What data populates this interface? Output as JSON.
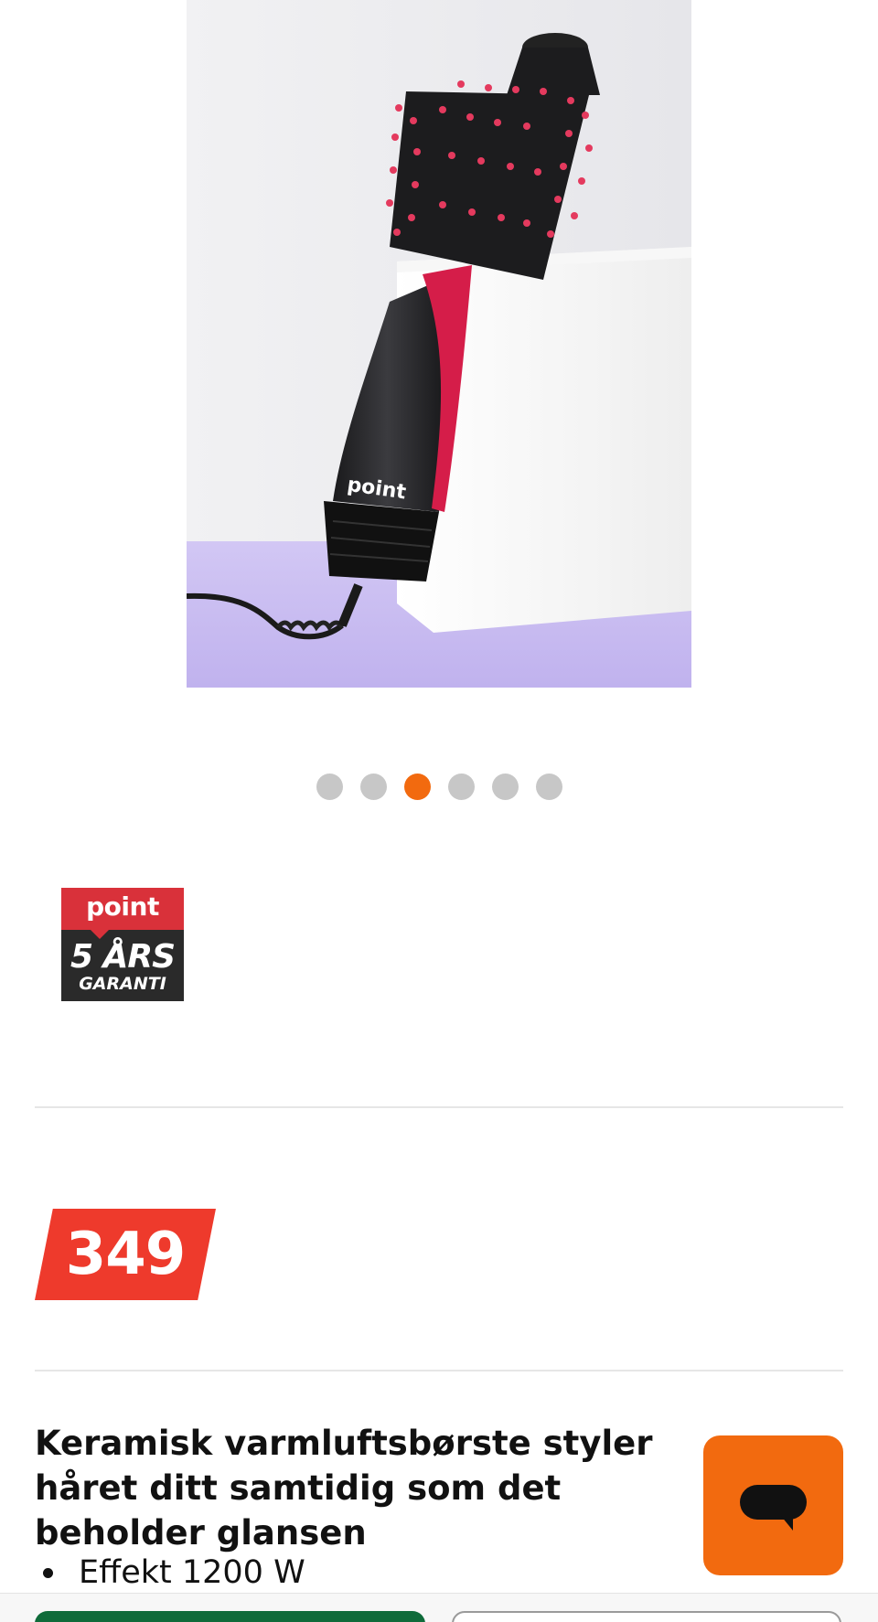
{
  "product": {
    "image_alt": "Keramisk varmluftsbørste",
    "image_brand_print": "point",
    "gallery": {
      "count": 6,
      "active_index": 2
    },
    "warranty_badge": {
      "brand": "point",
      "years": "5 ÅRS",
      "label": "GARANTI"
    },
    "price": "349",
    "headline": "Keramisk varmluftsbørste styler håret ditt samtidig som det beholder glansen",
    "features": [
      "Effekt 1200 W"
    ]
  },
  "chat": {
    "icon": "chat-bubble-icon"
  },
  "colors": {
    "accent_orange": "#f26a0f",
    "price_red": "#ee3a2c",
    "primary_green": "#0f6b3a",
    "dot_inactive": "#c7c7c7"
  }
}
